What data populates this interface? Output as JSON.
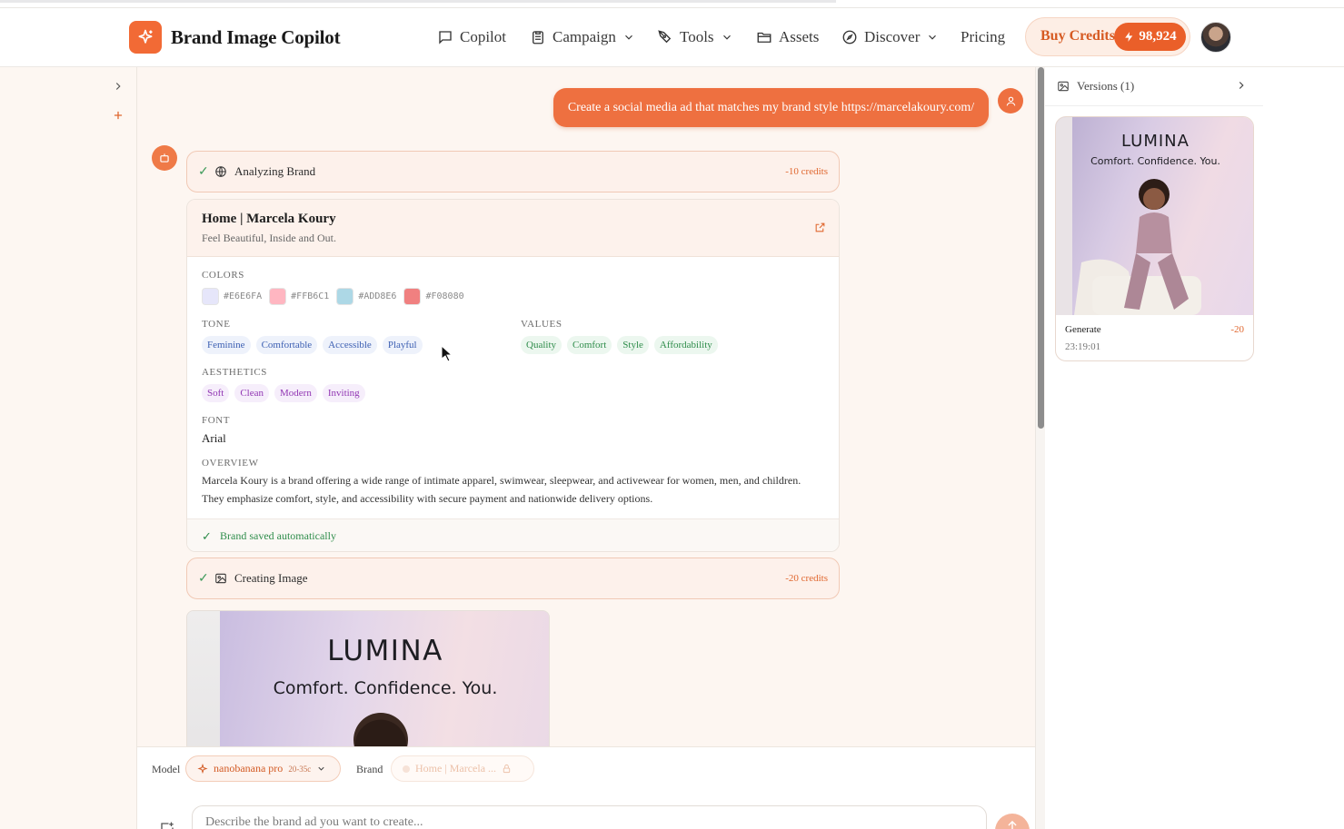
{
  "header": {
    "app_name": "Brand Image Copilot",
    "nav": [
      {
        "label": "Copilot"
      },
      {
        "label": "Campaign"
      },
      {
        "label": "Tools"
      },
      {
        "label": "Assets"
      },
      {
        "label": "Discover"
      },
      {
        "label": "Pricing"
      }
    ],
    "buy_credits_label": "Buy Credits",
    "credits_count": "98,924"
  },
  "chat": {
    "user_message": "Create a social media ad that matches my brand style https://marcelakoury.com/",
    "steps": [
      {
        "label": "Analyzing Brand",
        "credits": "-10 credits"
      },
      {
        "label": "Creating Image",
        "credits": "-20 credits"
      }
    ],
    "brand": {
      "title": "Home | Marcela Koury",
      "tagline": "Feel Beautiful, Inside and Out.",
      "colors_label": "COLORS",
      "colors": [
        {
          "hex": "#E6E6FA",
          "label": "#E6E6FA"
        },
        {
          "hex": "#FFB6C1",
          "label": "#FFB6C1"
        },
        {
          "hex": "#ADD8E6",
          "label": "#ADD8E6"
        },
        {
          "hex": "#F08080",
          "label": "#F08080"
        }
      ],
      "tone_label": "TONE",
      "tone": [
        "Feminine",
        "Comfortable",
        "Accessible",
        "Playful"
      ],
      "values_label": "VALUES",
      "values": [
        "Quality",
        "Comfort",
        "Style",
        "Affordability"
      ],
      "aesthetics_label": "AESTHETICS",
      "aesthetics": [
        "Soft",
        "Clean",
        "Modern",
        "Inviting"
      ],
      "font_label": "FONT",
      "font_value": "Arial",
      "overview_label": "OVERVIEW",
      "overview": "Marcela Koury is a brand offering a wide range of intimate apparel, swimwear, sleepwear, and activewear for women, men, and children. They emphasize comfort, style, and accessibility with secure payment and nationwide delivery options.",
      "saved_text": "Brand saved automatically"
    },
    "generated_image": {
      "headline": "LUMINA",
      "tagline": "Comfort. Confidence. You."
    }
  },
  "composer": {
    "model_label": "Model",
    "model_name": "nanobanana pro",
    "model_range": "20-35c",
    "brand_label": "Brand",
    "brand_value": "Home | Marcela ...",
    "placeholder": "Describe the brand ad you want to create..."
  },
  "versions": {
    "title": "Versions (1)",
    "items": [
      {
        "headline": "LUMINA",
        "tagline": "Comfort. Confidence. You.",
        "action": "Generate",
        "cost": "-20",
        "time": "23:19:01"
      }
    ]
  },
  "colors": {
    "accent": "#EE7040",
    "accent_dark": "#D65A22",
    "success": "#2F8D4B"
  }
}
